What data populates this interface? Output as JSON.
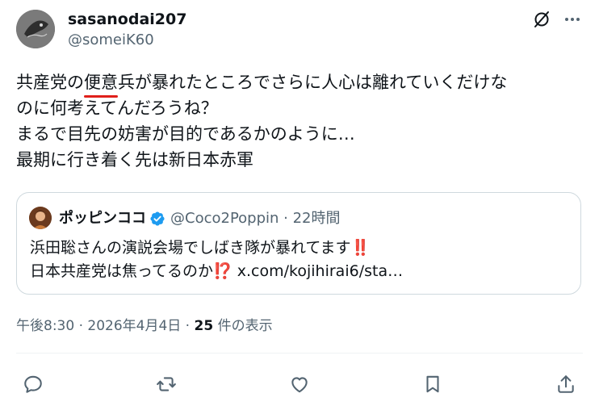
{
  "author": {
    "display_name": "sasanodai207",
    "handle": "@someiK60"
  },
  "tweet": {
    "line1_a": "共産党の",
    "line1_underlined": "便意",
    "line1_b": "兵が暴れたところでさらに人心は離れていくだけな",
    "line2": "のに何考えてんだろうね？",
    "line3": "まるで目先の妨害が目的であるかのように…",
    "line4": "最期に行き着く先は新日本赤軍"
  },
  "quote": {
    "display_name": "ポッピンココ",
    "meta": "@Coco2Poppin · 22時間",
    "line1_text": "浜田聡さんの演説会場でしばき隊が暴れてます",
    "line1_emoji": "‼️",
    "line2_text": "日本共産党は焦ってるのか",
    "line2_emoji": "⁉️",
    "line2_link": " x.com/kojihirai6/sta…"
  },
  "meta": {
    "timestamp": "午後8:30 · 2026年4月4日 · ",
    "views_count": "25",
    "views_label": " 件の表示"
  },
  "icons": {
    "grok": "grok-icon",
    "more": "more-icon",
    "verified": "verified-badge-icon",
    "reply": "reply-icon",
    "retweet": "retweet-icon",
    "like": "like-icon",
    "bookmark": "bookmark-icon",
    "share": "share-icon"
  },
  "colors": {
    "text": "#0f1419",
    "secondary": "#536471",
    "border": "#cfd9de",
    "verified": "#1d9bf0",
    "underline": "#e0201b"
  }
}
